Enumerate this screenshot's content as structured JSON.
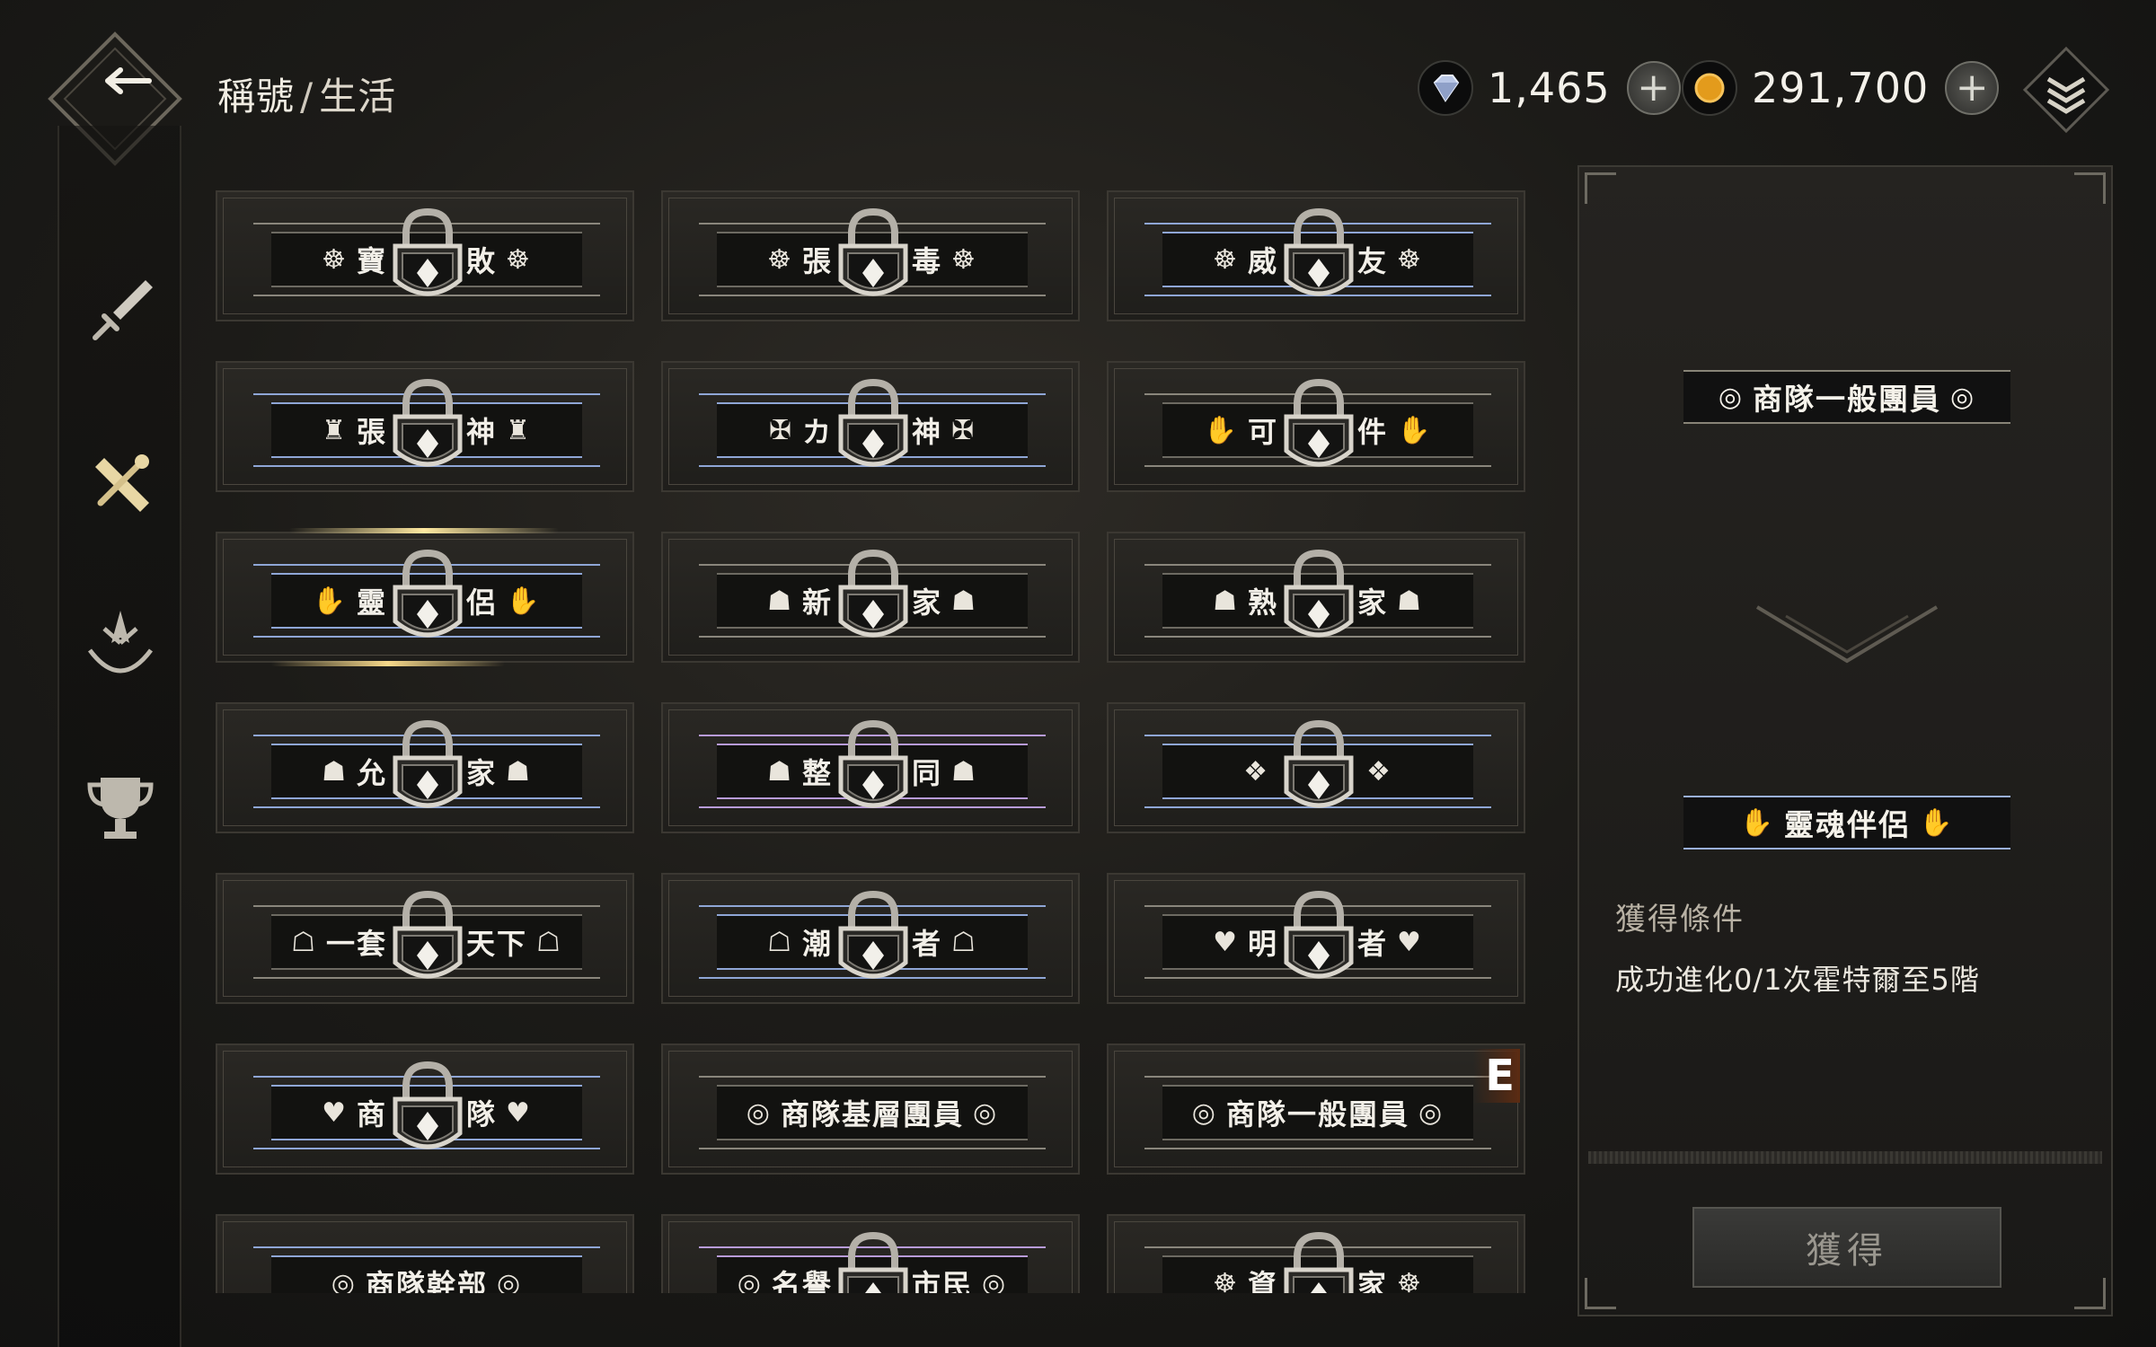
{
  "header": {
    "title": "稱號",
    "separator": "/",
    "subtitle": "生活",
    "currencies": [
      {
        "icon": "diamond-icon",
        "value": "1,465"
      },
      {
        "icon": "gold-coin-icon",
        "value": "291,700"
      }
    ],
    "plus_label": "+"
  },
  "sidebar": {
    "tabs": [
      {
        "icon": "sword-icon",
        "active": false
      },
      {
        "icon": "crossed-tools-icon",
        "active": true
      },
      {
        "icon": "emblem-icon",
        "active": false
      },
      {
        "icon": "trophy-icon",
        "active": false
      }
    ]
  },
  "titles": [
    {
      "left": "寶",
      "right": "敗",
      "emb": "☸",
      "style": "plain",
      "locked": true
    },
    {
      "left": "張",
      "right": "毒",
      "emb": "☸",
      "style": "plain",
      "locked": true
    },
    {
      "left": "威",
      "right": "友",
      "emb": "☸",
      "style": "blue",
      "locked": true
    },
    {
      "left": "張",
      "right": "神",
      "emb": "♜",
      "style": "blue",
      "locked": true
    },
    {
      "left": "カ",
      "right": "神",
      "emb": "✠",
      "style": "blue",
      "locked": true
    },
    {
      "left": "可",
      "right": "件",
      "emb": "✋",
      "style": "plain",
      "locked": true
    },
    {
      "left": "靈",
      "right": "侶",
      "emb": "✋",
      "style": "blue",
      "locked": true,
      "selected": true
    },
    {
      "left": "新",
      "right": "家",
      "emb": "☗",
      "style": "plain",
      "locked": true
    },
    {
      "left": "熟",
      "right": "家",
      "emb": "☗",
      "style": "plain",
      "locked": true
    },
    {
      "left": "允",
      "right": "家",
      "emb": "☗",
      "style": "blue",
      "locked": true
    },
    {
      "left": "整",
      "right": "同",
      "emb": "☗",
      "style": "purple",
      "locked": true
    },
    {
      "left": "",
      "right": "",
      "emb": "❖",
      "style": "blue",
      "locked": true
    },
    {
      "left": "一套",
      "right": "天下",
      "emb": "☖",
      "style": "plain",
      "locked": true
    },
    {
      "left": "潮",
      "right": "者",
      "emb": "☖",
      "style": "blue",
      "locked": true
    },
    {
      "left": "明",
      "right": "者",
      "emb": "♥",
      "style": "plain",
      "locked": true
    },
    {
      "left": "商",
      "right": "隊",
      "emb": "♥",
      "style": "blue",
      "locked": true
    },
    {
      "text": "商隊基層團員",
      "emb": "◎",
      "style": "plain",
      "locked": false
    },
    {
      "text": "商隊一般團員",
      "emb": "◎",
      "style": "plain",
      "locked": false,
      "equipped": true
    },
    {
      "text": "商隊幹部",
      "emb": "◎",
      "style": "blue",
      "locked": false
    },
    {
      "left": "名譽",
      "right": "市民",
      "emb": "◎",
      "style": "purple",
      "locked": true
    },
    {
      "left": "資",
      "right": "家",
      "emb": "☸",
      "style": "plain",
      "locked": true
    }
  ],
  "equipped_badge": "E",
  "detail": {
    "current_title": "商隊一般團員",
    "current_emb": "◎",
    "next_title": "靈魂伴侶",
    "next_emb": "✋",
    "condition_title": "獲得條件",
    "condition_text": "成功進化0/1次霍特爾至5階",
    "obtain_label": "獲得"
  }
}
